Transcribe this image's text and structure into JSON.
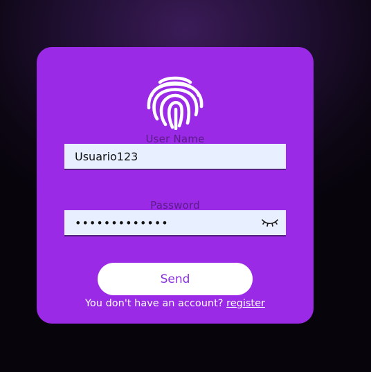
{
  "colors": {
    "card_background": "#9a2ae6",
    "input_background": "#e8effe",
    "label_color": "#5c1b8a",
    "button_text": "#8b2ee0"
  },
  "icons": {
    "logo": "fingerprint-icon",
    "password_toggle": "eye-closed-icon"
  },
  "form": {
    "username_label": "User Name",
    "username_value": "Usuario123",
    "password_label": "Password",
    "password_value": "•••••••••••••",
    "send_label": "Send"
  },
  "footer": {
    "prompt": "You don't have an account?",
    "register_link": "register"
  }
}
